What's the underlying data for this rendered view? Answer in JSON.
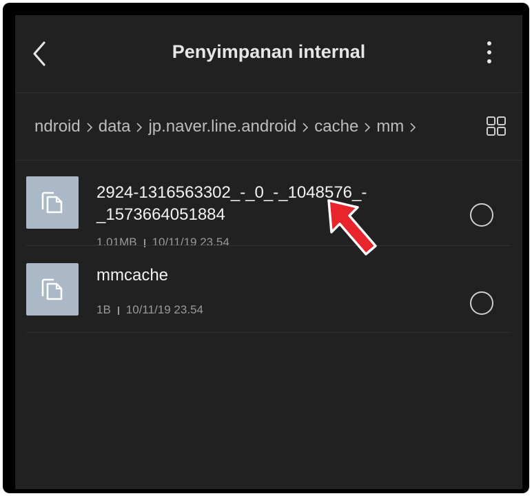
{
  "header": {
    "title": "Penyimpanan internal",
    "back_icon": "chevron-left-icon",
    "menu_icon": "more-vertical-icon"
  },
  "breadcrumb": {
    "items": [
      "ndroid",
      "data",
      "jp.naver.line.android",
      "cache",
      "mm"
    ],
    "view_toggle_icon": "grid-view-icon"
  },
  "files": [
    {
      "name_line1": "2924-1316563302_-_0_-_1048576_-",
      "name_line2": "_1573664051884",
      "size": "1.01MB",
      "date": "10/11/19 23.54",
      "icon": "file-copy-icon"
    },
    {
      "name_line1": "mmcache",
      "size": "1B",
      "date": "10/11/19 23.54",
      "icon": "file-copy-icon"
    }
  ],
  "colors": {
    "background": "#212121",
    "thumbnail": "#aab8c7",
    "annotation_arrow": "#e8242c"
  }
}
